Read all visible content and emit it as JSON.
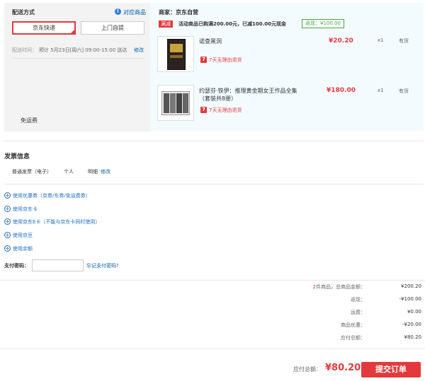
{
  "delivery": {
    "heading": "配送方式",
    "matching_products_link": "对应商品",
    "options": [
      "京东快递",
      "上门自提"
    ],
    "time_label": "配送时间：",
    "time_value": "预计 5月23日[周六] 09:00-15:00 送达",
    "edit_link": "修改",
    "free_shipping": "免运费"
  },
  "seller": {
    "label": "商家：京东自营",
    "promo_tag": "满减",
    "promo_text": "活动商品已购满200.00元，已减100.00元现金",
    "rebate_badge": "返现：¥100.00"
  },
  "items": [
    {
      "title": "诺查黑洞",
      "price": "¥20.20",
      "qty": "x1",
      "stock": "有货",
      "return_icon": "7",
      "return_text": "7天无理由退货"
    },
    {
      "title": "约瑟芬·铁伊：推理黄金期女王作品全集（套装共8册）",
      "price": "¥180.00",
      "qty": "x1",
      "stock": "有货",
      "return_icon": "7",
      "return_text": "7天无理由退货"
    }
  ],
  "invoice": {
    "heading": "发票信息",
    "type": "普通发票（电子）",
    "title": "个人",
    "detail": "明细",
    "edit_link": "修改"
  },
  "options": [
    {
      "label": "使用优惠券（京券/东券/免运费券）"
    },
    {
      "label": "使用京东卡"
    },
    {
      "label": "使用京东E卡（不能与京东卡同时使用）"
    },
    {
      "label": "使用京豆"
    },
    {
      "label": "使用余额"
    }
  ],
  "password": {
    "label": "支付密码：",
    "value": "",
    "forgot_link": "忘记支付密码?"
  },
  "summary": {
    "count": "2",
    "count_label": "件商品，总商品金额：",
    "total_goods": "¥200.20",
    "rows": [
      {
        "label": "返现：",
        "value": "-¥100.00"
      },
      {
        "label": "运费：",
        "value": "¥0.00"
      },
      {
        "label": "商品优惠：",
        "value": "-¥20.00"
      },
      {
        "label": "应付总额：",
        "value": "¥80.20"
      }
    ]
  },
  "footer": {
    "payable_label": "应付总额：",
    "payable_value": "¥80.20",
    "submit_label": "提交订单"
  },
  "colors": {
    "accent_red": "#e4393c",
    "link_blue": "#005ea7",
    "green": "#3fa83f"
  }
}
